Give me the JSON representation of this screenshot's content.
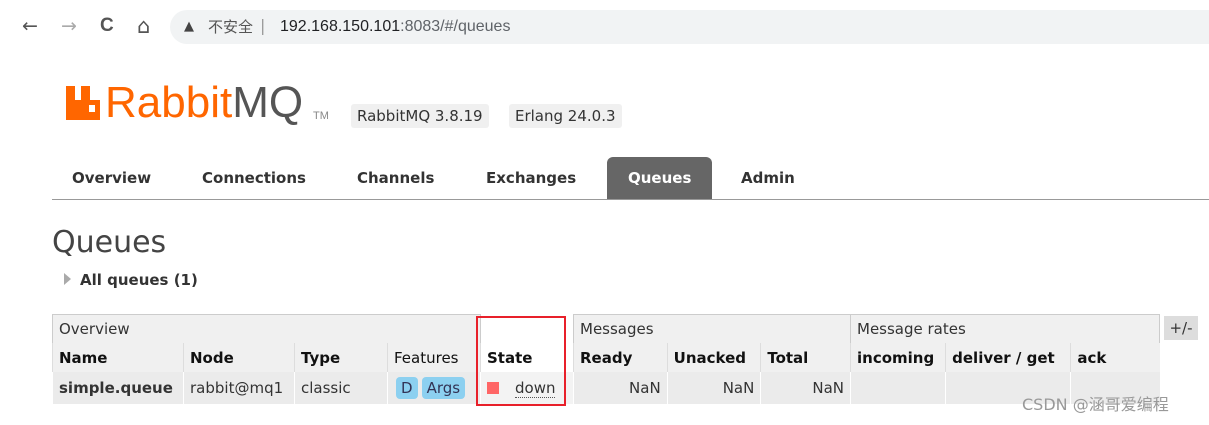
{
  "browser": {
    "back_icon": "←",
    "forward_icon": "→",
    "reload_icon": "C",
    "home_icon": "⌂",
    "warning_icon": "▲",
    "insecure_label": "不安全",
    "separator": "|",
    "url_host": "192.168.150.101",
    "url_rest": ":8083/#/queues"
  },
  "logo": {
    "text_rabbit": "Rabbit",
    "text_mq": "MQ",
    "tm": "TM",
    "brand_color": "#ff6600"
  },
  "versions": [
    "RabbitMQ 3.8.19",
    "Erlang 24.0.3"
  ],
  "tabs": [
    {
      "label": "Overview",
      "active": false
    },
    {
      "label": "Connections",
      "active": false
    },
    {
      "label": "Channels",
      "active": false
    },
    {
      "label": "Exchanges",
      "active": false
    },
    {
      "label": "Queues",
      "active": true
    },
    {
      "label": "Admin",
      "active": false
    }
  ],
  "page_title": "Queues",
  "section_toggle": "All queues (1)",
  "table": {
    "groups": [
      "Overview",
      "Messages",
      "Message rates"
    ],
    "columns": [
      "Name",
      "Node",
      "Type",
      "Features",
      "State",
      "Ready",
      "Unacked",
      "Total",
      "incoming",
      "deliver / get",
      "ack"
    ],
    "rows": [
      {
        "name": "simple.queue",
        "node": "rabbit@mq1",
        "type": "classic",
        "features": [
          "D",
          "Args"
        ],
        "state": "down",
        "ready": "NaN",
        "unacked": "NaN",
        "total": "NaN",
        "incoming": "",
        "deliver_get": "",
        "ack": ""
      }
    ],
    "columns_toggle": "+/-"
  },
  "colors": {
    "state_down": "#ff6666",
    "highlight": "#e8202a",
    "feature_badge": "#8cd0f0",
    "active_tab": "#666666"
  },
  "watermark": "CSDN @涵哥爱编程"
}
